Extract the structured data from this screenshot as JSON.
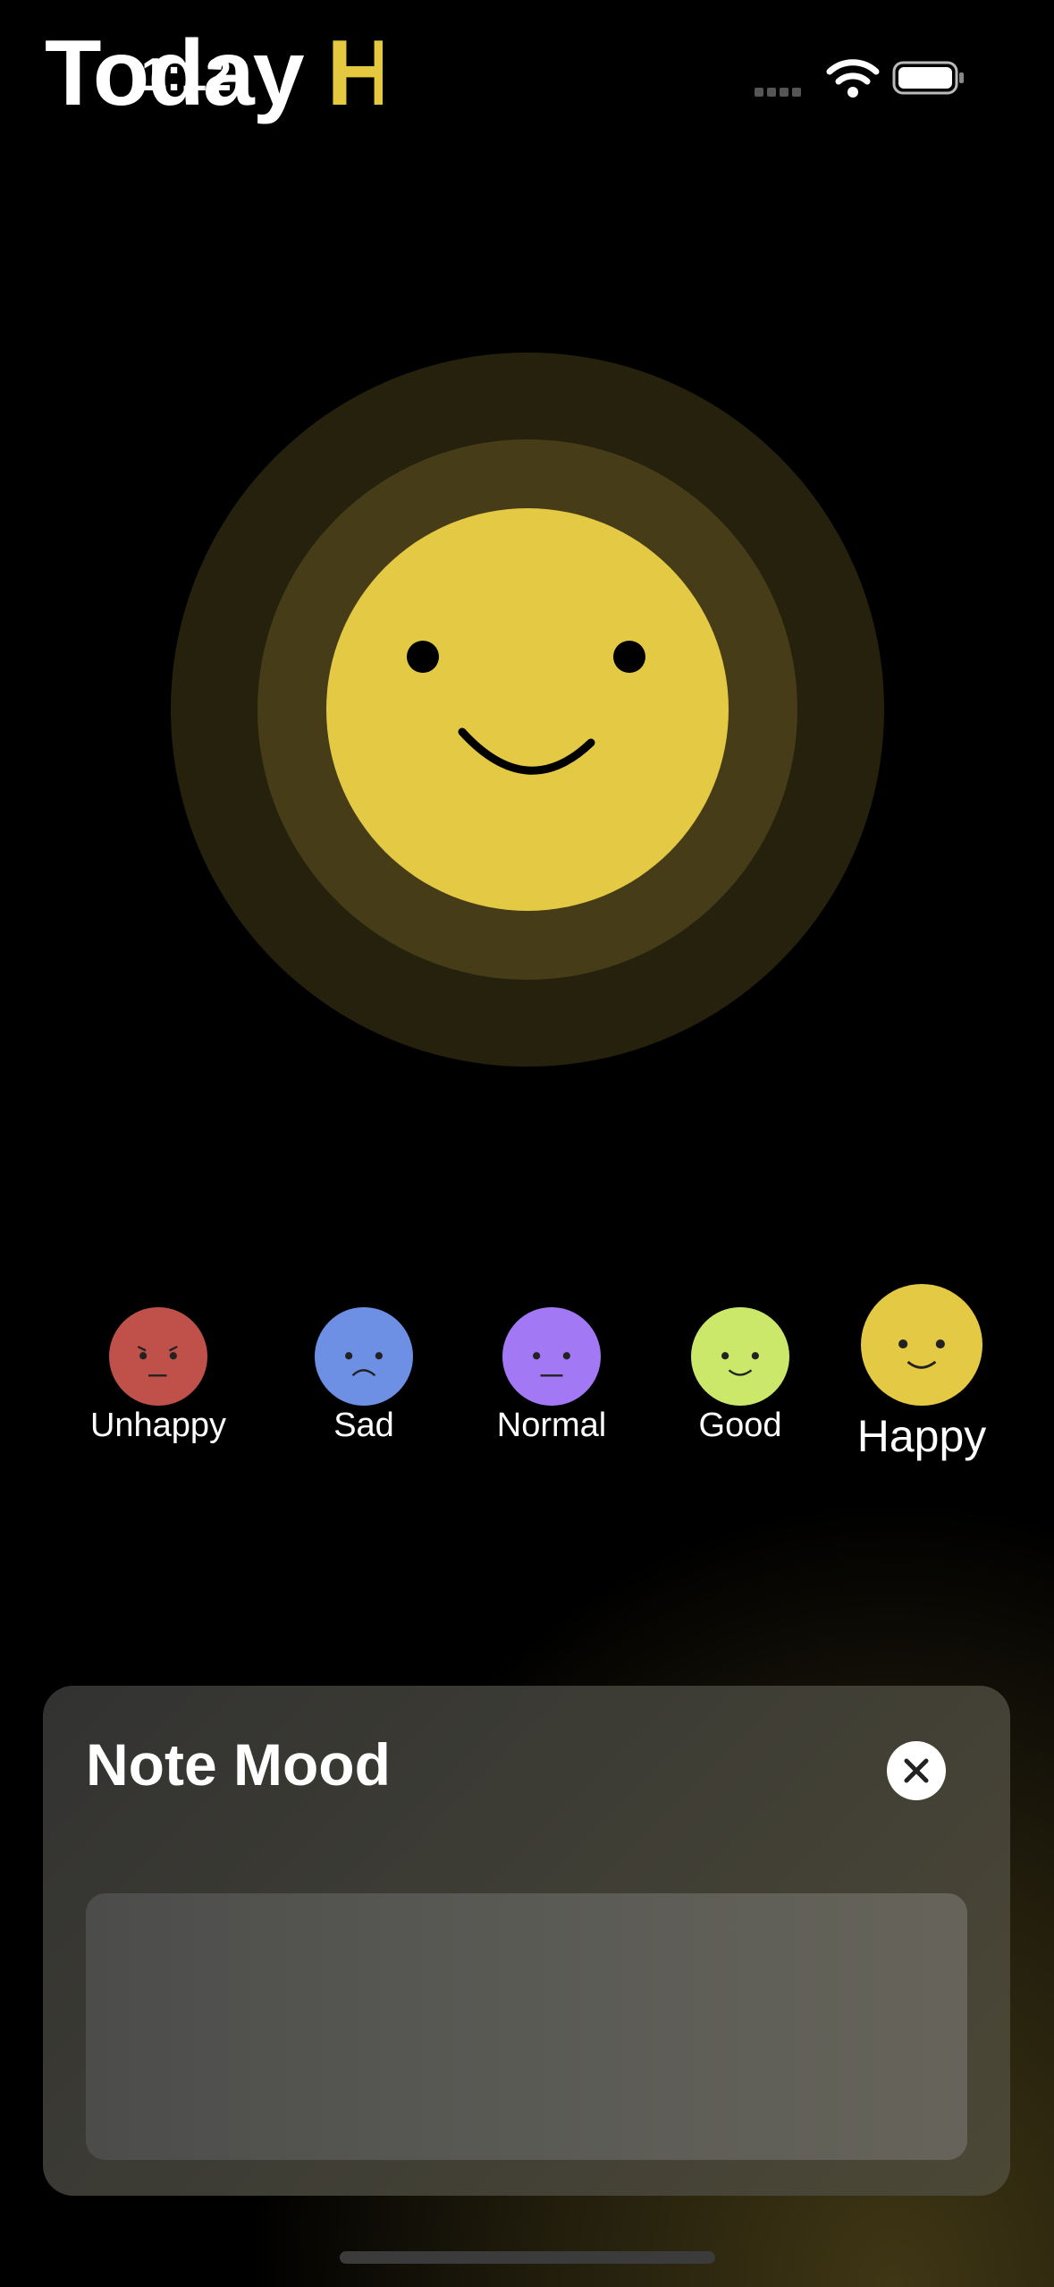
{
  "status_bar": {
    "time": "1:12"
  },
  "header": {
    "title_main": "Today",
    "title_accent": "H"
  },
  "selected_mood": "Happy",
  "moods": [
    {
      "label": "Unhappy",
      "color": "#c0504a",
      "expression": "angry"
    },
    {
      "label": "Sad",
      "color": "#6d8fe4",
      "expression": "frown"
    },
    {
      "label": "Normal",
      "color": "#a378f4",
      "expression": "flat"
    },
    {
      "label": "Good",
      "color": "#cbe86a",
      "expression": "smile"
    },
    {
      "label": "Happy",
      "color": "#e4c945",
      "expression": "smile"
    }
  ],
  "note": {
    "title": "Note Mood",
    "value": "",
    "placeholder": ""
  },
  "colors": {
    "accent": "#e4c945",
    "background": "#000000"
  }
}
